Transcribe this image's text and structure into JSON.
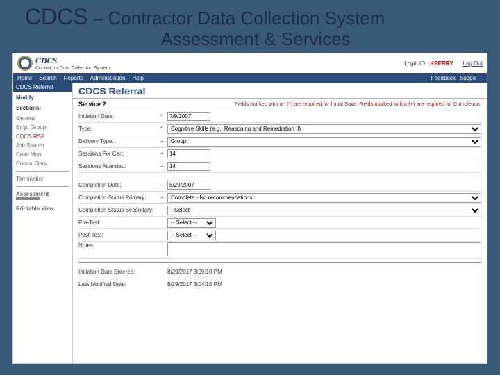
{
  "slide": {
    "title_prefix": "CDCS",
    "title_dash": " – ",
    "title_rest": "Contractor Data Collection System",
    "subtitle": "Assessment & Services"
  },
  "header": {
    "brand1": "CDCS",
    "brand2": "Contractor Data Collection System",
    "login_label": "Login ID:",
    "login_user": "KPERRY",
    "logout": "Log Out"
  },
  "menu": {
    "home": "Home",
    "search": "Search",
    "reports": "Reports",
    "admin": "Administration",
    "help": "Help",
    "feedback": "Feedback",
    "support": "Suppo"
  },
  "sidebar": {
    "header": "CDCS Referral",
    "modify": "Modify",
    "sections": "Sections:",
    "items": {
      "general": "General",
      "empgrp": "Emp. Group",
      "cdcsrsr": "CDCS RSR",
      "jobsearch": "Job Search",
      "caseman": "Case Man.",
      "commserv": "Comm. Serv.",
      "termination": "Termination",
      "assessment": "Assessment",
      "printable": "Printable View"
    }
  },
  "main": {
    "title": "CDCS Referral",
    "service_label": "Service 2",
    "req_note": "Fields marked with an (*) are required for Initial Save. Fields marked with a (+) are required for Completion."
  },
  "form": {
    "initiation_date": {
      "label": "Initiation Date:",
      "mark": "*",
      "value": "7/9/2007"
    },
    "type": {
      "label": "Type:",
      "mark": "*",
      "value": "Cognitive Skills (e.g., Reasoning and Remediation II)"
    },
    "delivery_type": {
      "label": "Delivery Type:",
      "mark": "+",
      "value": "Group"
    },
    "sessions_for_cert": {
      "label": "Sessions For Cert:",
      "mark": "+",
      "value": "14"
    },
    "sessions_attended": {
      "label": "Sessions Attended:",
      "mark": "+",
      "value": "14"
    },
    "completion_date": {
      "label": "Completion Date:",
      "mark": "+",
      "value": "8/29/2007"
    },
    "completion_status_primary": {
      "label": "Completion Status Primary:",
      "mark": "+",
      "value": "Complete - No recommendations"
    },
    "completion_status_secondary": {
      "label": "Completion Status Secondary:",
      "mark": "",
      "value": "- Select -"
    },
    "pre_test": {
      "label": "Pre-Test:",
      "mark": "",
      "value": "-- Select --"
    },
    "post_test": {
      "label": "Post-Test:",
      "mark": "",
      "value": "-- Select --"
    },
    "notes": {
      "label": "Notes:",
      "mark": "",
      "value": ""
    },
    "initiation_entered": {
      "label": "Initiation Date Entered:",
      "value": "8/29/2017 3:09:10 PM"
    },
    "last_modified": {
      "label": "Last Modified Date:",
      "value": "8/29/2017 3:04:15 PM"
    }
  }
}
